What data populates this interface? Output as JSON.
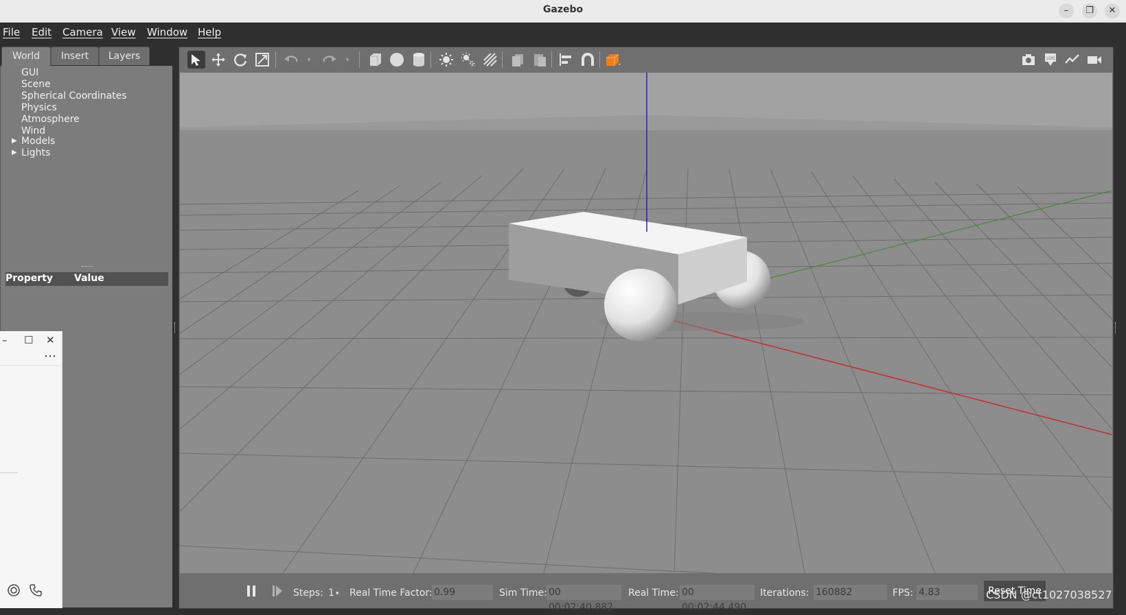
{
  "window": {
    "title": "Gazebo",
    "minimize": "–",
    "restore": "❐",
    "close": "✕"
  },
  "menu": [
    "File",
    "Edit",
    "Camera",
    "View",
    "Window",
    "Help"
  ],
  "left_panel": {
    "tabs": [
      "World",
      "Insert",
      "Layers"
    ],
    "active_tab": "World",
    "tree": [
      "GUI",
      "Scene",
      "Spherical Coordinates",
      "Physics",
      "Atmosphere",
      "Wind",
      "Models",
      "Lights"
    ],
    "property_header": {
      "property": "Property",
      "value": "Value"
    }
  },
  "toolbar": {
    "icons": [
      "select-arrow-icon",
      "translate-icon",
      "rotate-icon",
      "scale-icon",
      "undo-icon",
      "redo-icon",
      "box-icon",
      "sphere-icon",
      "cylinder-icon",
      "point-light-icon",
      "spot-light-icon",
      "directional-light-icon",
      "copy-icon",
      "paste-icon",
      "align-icon",
      "snap-icon",
      "view-angle-icon",
      "screenshot-icon",
      "log-icon",
      "plot-icon",
      "video-icon"
    ]
  },
  "scene": {
    "axis_colors": {
      "x": "#cc2a2a",
      "y": "#3c8c2c",
      "z": "#2222cc"
    }
  },
  "bottom_bar": {
    "steps_label": "Steps:",
    "steps_value": "1",
    "rtf_label": "Real Time Factor:",
    "rtf_value": "0.99",
    "sim_time_label": "Sim Time:",
    "sim_time_value": "00 00:02:40.882",
    "real_time_label": "Real Time:",
    "real_time_value": "00 00:02:44.490",
    "iterations_label": "Iterations:",
    "iterations_value": "160882",
    "fps_label": "FPS:",
    "fps_value": "4.83",
    "reset_label": "Reset Time"
  },
  "overlay_window": {
    "minimize": "–",
    "maximize": "☐",
    "close": "✕",
    "more": "⋯"
  },
  "watermark": "CSDN @ct1027038527"
}
